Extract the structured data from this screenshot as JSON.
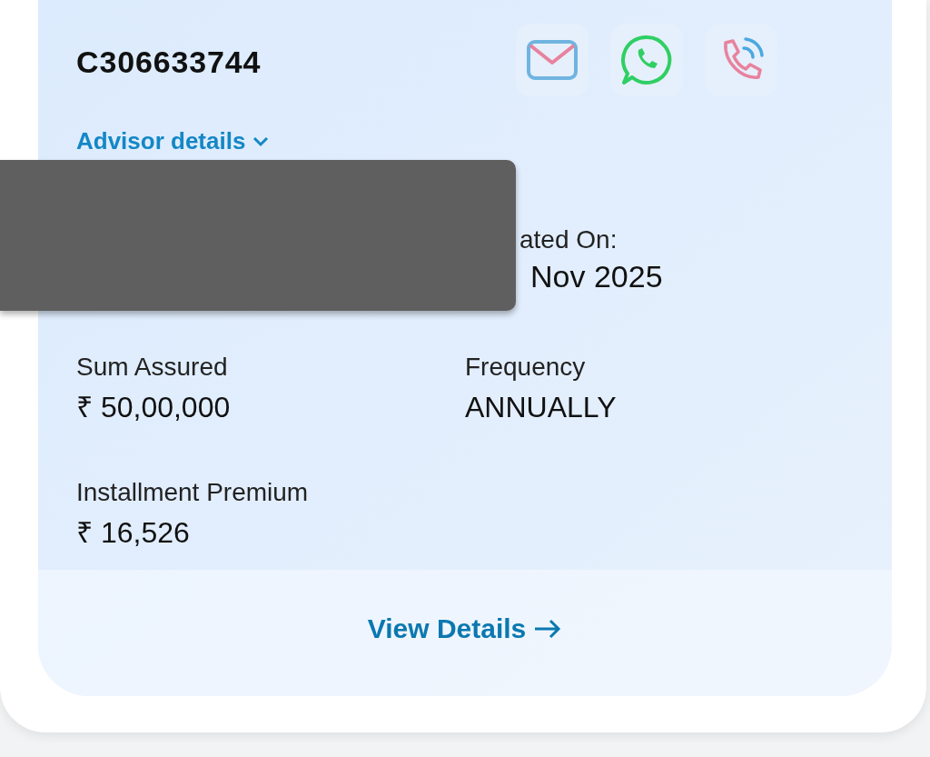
{
  "policy_number": "C306633744",
  "contact_actions": [
    {
      "kind": "email"
    },
    {
      "kind": "whatsapp"
    },
    {
      "kind": "call"
    }
  ],
  "advisor_link": "Advisor details",
  "redacted": true,
  "created_on": {
    "label": "ated On:",
    "value": "Nov 2025"
  },
  "fields": [
    {
      "label": "Sum Assured",
      "value": "₹ 50,00,000"
    },
    {
      "label": "Frequency",
      "value": "ANNUALLY"
    },
    {
      "label": "Installment Premium",
      "value": "₹ 16,526"
    }
  ],
  "view_details": "View Details"
}
